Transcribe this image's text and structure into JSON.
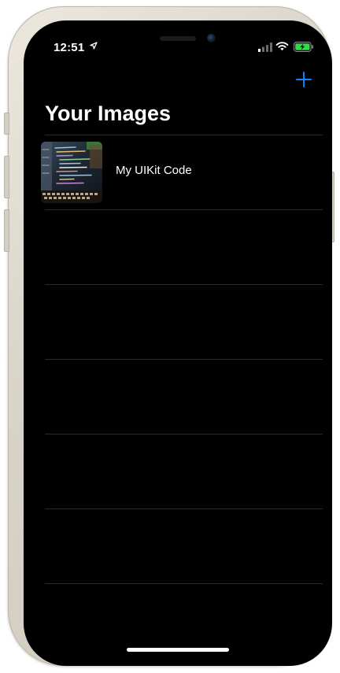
{
  "status_bar": {
    "time": "12:51"
  },
  "nav": {
    "title": "Your Images",
    "add_icon": "plus-icon",
    "accent_color": "#0a84ff"
  },
  "list": {
    "items": [
      {
        "label": "My UIKit Code",
        "thumbnail": "code-screen-photo"
      }
    ],
    "empty_rows": 5
  },
  "colors": {
    "background": "#000000",
    "text": "#ffffff",
    "separator": "#2a2a2a"
  }
}
